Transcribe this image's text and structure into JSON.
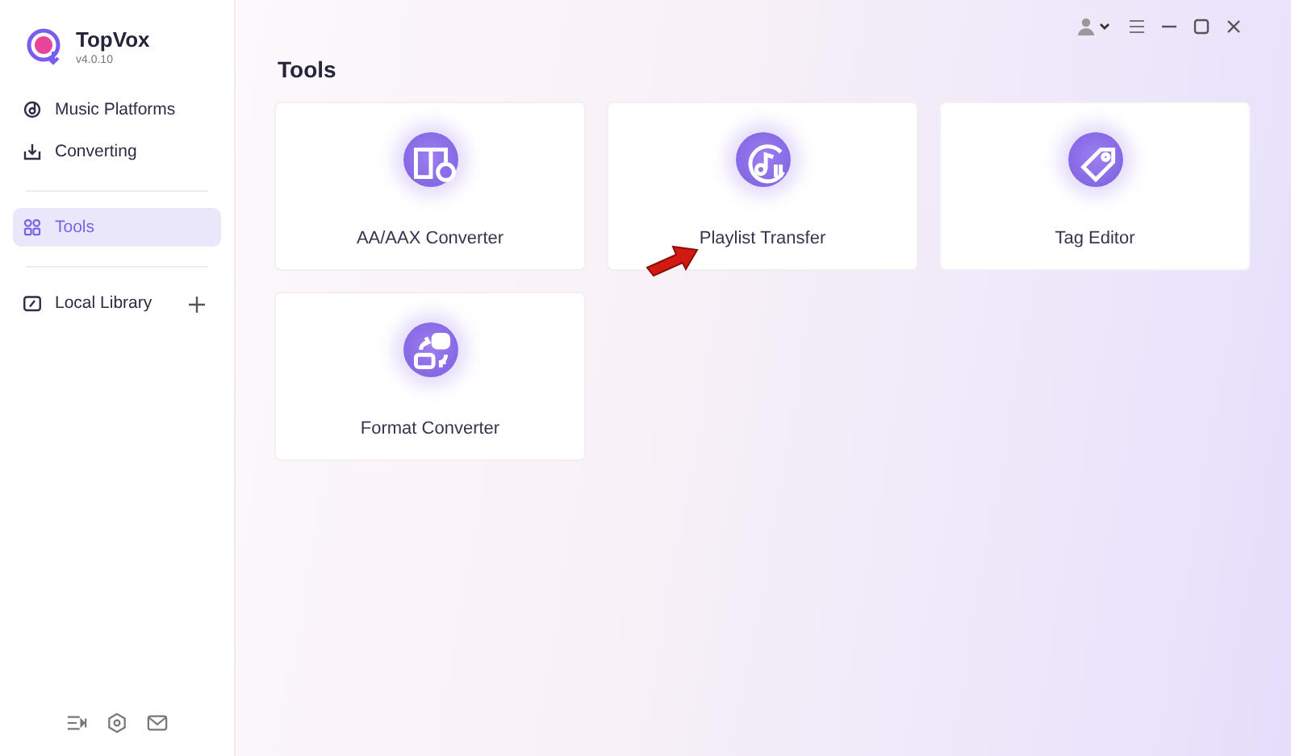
{
  "app": {
    "name": "TopVox",
    "version": "v4.0.10"
  },
  "sidebar": {
    "items": [
      {
        "label": "Music Platforms",
        "selected": false
      },
      {
        "label": "Converting",
        "selected": false
      },
      {
        "label": "Tools",
        "selected": true
      },
      {
        "label": "Local Library",
        "selected": false,
        "add": true
      }
    ]
  },
  "page": {
    "title": "Tools"
  },
  "tools": [
    {
      "label": "AA/AAX Converter",
      "pointer": false
    },
    {
      "label": "Playlist Transfer",
      "pointer": true
    },
    {
      "label": "Tag Editor",
      "pointer": false
    },
    {
      "label": "Format Converter",
      "pointer": false
    }
  ]
}
